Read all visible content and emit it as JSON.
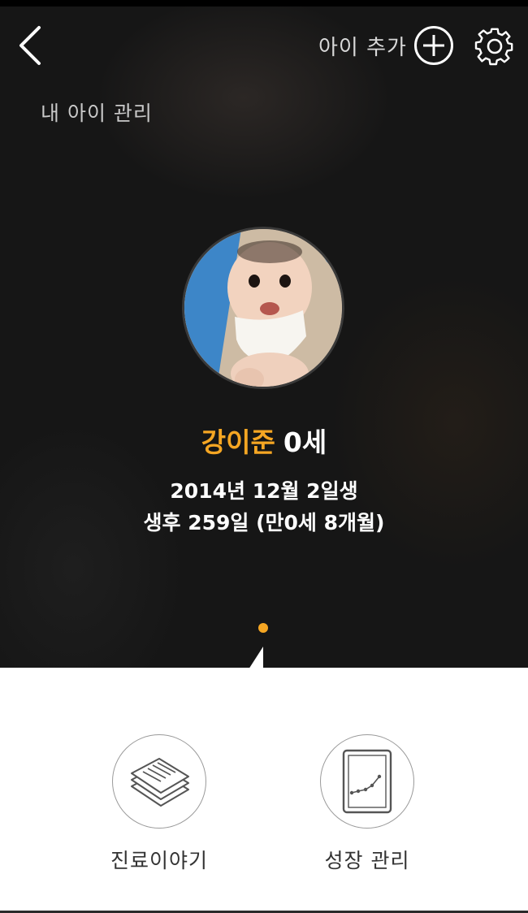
{
  "header": {
    "add_child_label": "아이 추가",
    "section_title": "내 아이 관리"
  },
  "profile": {
    "name": "강이준",
    "age": "0세",
    "birth": "2014년 12월 2일생",
    "days": "생후 259일 (만0세 8개월)"
  },
  "menu": {
    "items": [
      {
        "label": "진료이야기",
        "icon": "documents-icon"
      },
      {
        "label": "성장 관리",
        "icon": "growth-chart-icon"
      }
    ]
  },
  "colors": {
    "accent": "#f5a623",
    "hero_bg": "#161616",
    "bottom_bg": "#ffffff"
  }
}
